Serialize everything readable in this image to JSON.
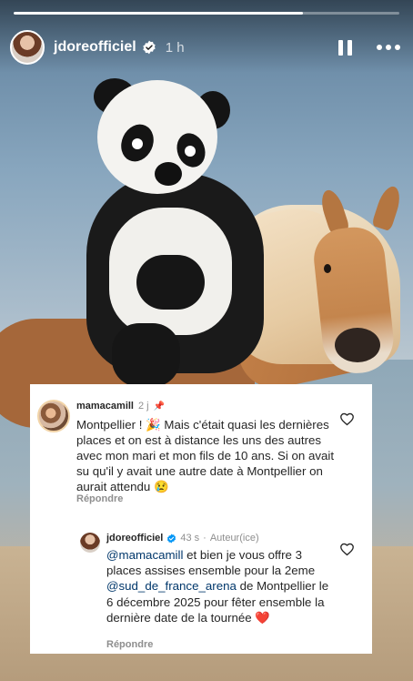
{
  "story": {
    "username": "jdoreofficiel",
    "time": "1 h",
    "progress": 0.75
  },
  "comment": {
    "username": "mamacamill",
    "time": "2 j",
    "text": "Montpellier ! 🎉 Mais c'était quasi les dernières places et on est à distance les uns des autres avec mon mari et mon fils de 10 ans. Si on avait su qu'il y avait une autre date à Montpellier on aurait attendu 😢",
    "reply_label": "Répondre"
  },
  "reply": {
    "username": "jdoreofficiel",
    "time": "43 s",
    "badge": "Auteur(ice)",
    "mention_user": "@mamacamill",
    "text_part1": " et bien je vous offre 3 places assises ensemble pour la 2eme ",
    "mention_arena": "@sud_de_france_arena",
    "text_part2": " de Montpellier le 6 décembre 2025 pour fêter ensemble la dernière date de la tournée ❤️",
    "reply_label": "Répondre"
  },
  "icons": {
    "verified": "verified-badge-icon",
    "pause": "pause-icon",
    "more": "more-icon",
    "pin": "pin-icon",
    "like": "heart-icon"
  },
  "colors": {
    "verified_blue": "#0095f6",
    "mention": "#00376b",
    "muted": "#8e8e8e",
    "heart_red": "#ed4956"
  }
}
